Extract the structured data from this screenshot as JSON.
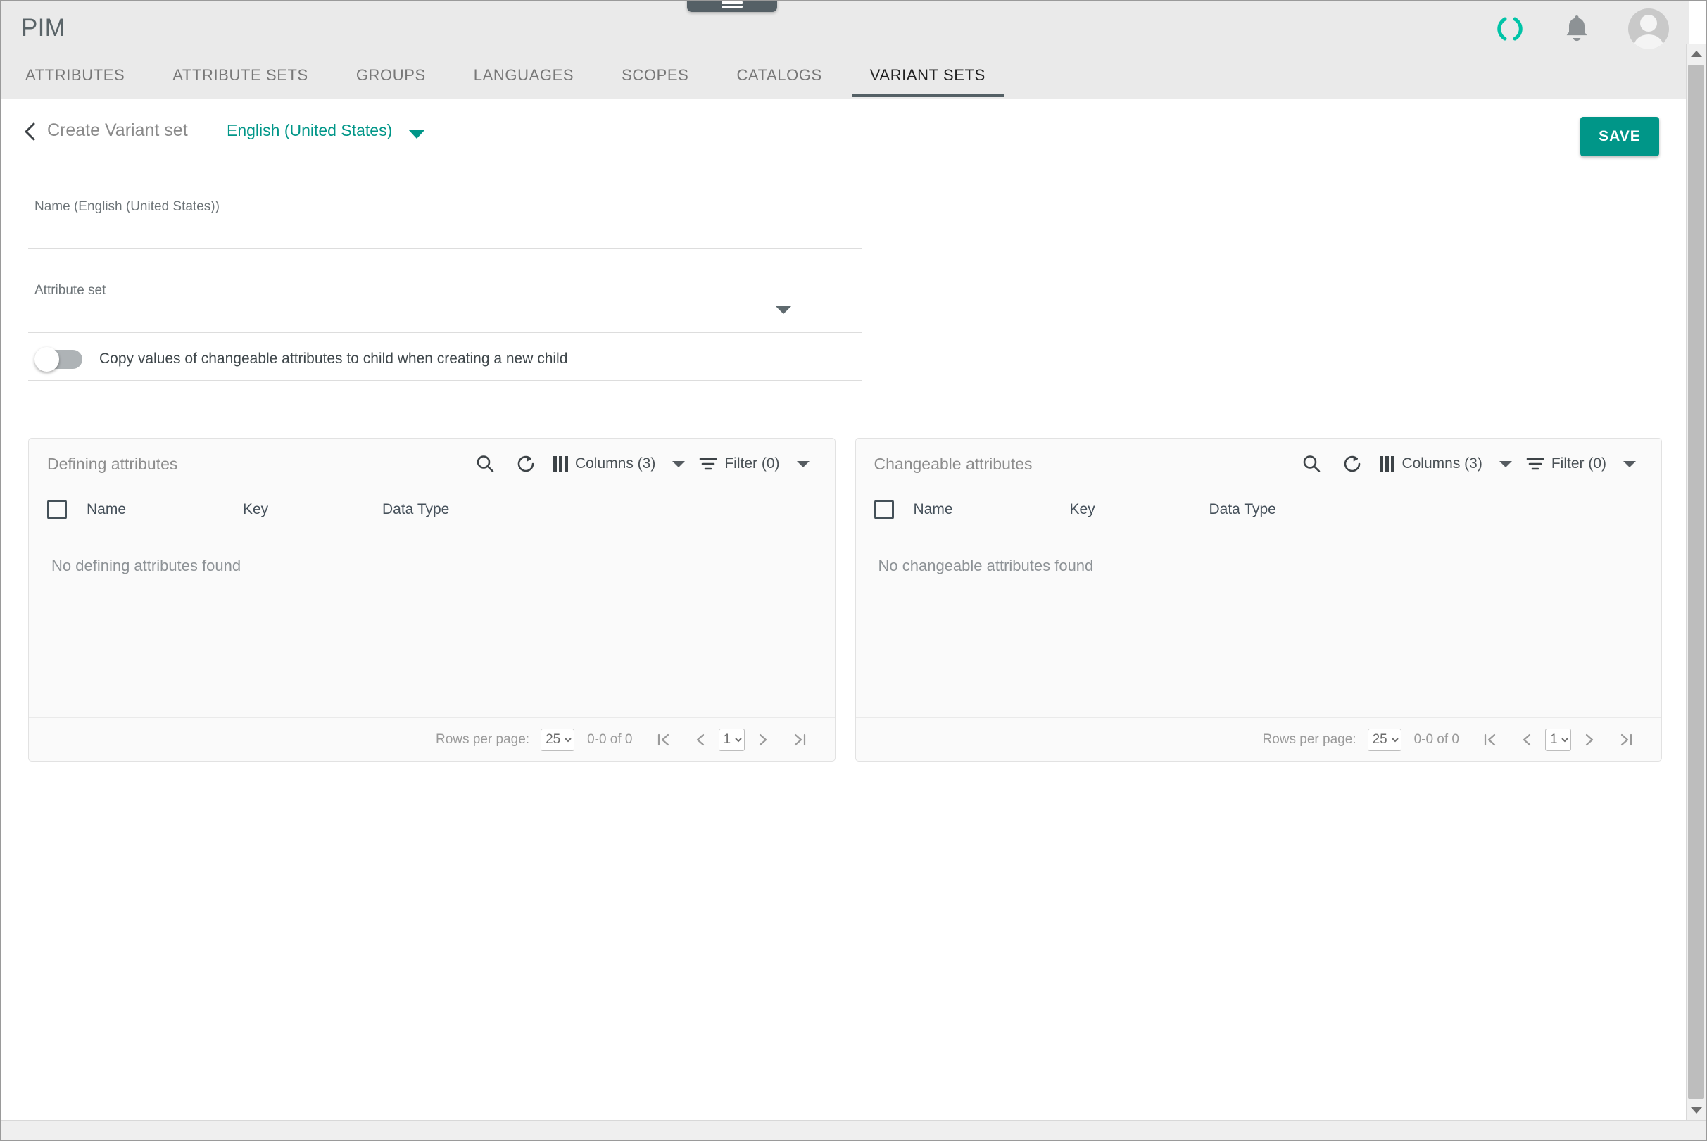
{
  "app": {
    "title": "PIM",
    "menu_tab_icon": "hamburger-icon",
    "status_icon": "loading-spinner-icon",
    "notifications_icon": "bell-icon",
    "avatar_icon": "user-avatar-icon",
    "accent_color": "#009688",
    "appbar_bg": "#eaeaea",
    "active_tab_underline": "#546065"
  },
  "tabs": [
    {
      "label": "ATTRIBUTES",
      "active": false
    },
    {
      "label": "ATTRIBUTE SETS",
      "active": false
    },
    {
      "label": "GROUPS",
      "active": false
    },
    {
      "label": "LANGUAGES",
      "active": false
    },
    {
      "label": "SCOPES",
      "active": false
    },
    {
      "label": "CATALOGS",
      "active": false
    },
    {
      "label": "VARIANT SETS",
      "active": true
    }
  ],
  "subheader": {
    "back_icon": "chevron-left-icon",
    "title": "Create Variant set",
    "language": "English (United States)",
    "language_caret_icon": "caret-down-icon",
    "save_label": "SAVE"
  },
  "form": {
    "name_label": "Name (English (United States))",
    "name_value": "",
    "name_placeholder": "",
    "attribute_set_label": "Attribute set",
    "attribute_set_value": "",
    "attribute_set_placeholder": "",
    "attribute_set_caret_icon": "caret-down-icon",
    "copy_toggle_label": "Copy values of changeable attributes to child when creating a new child",
    "copy_toggle_state": "off"
  },
  "panels": [
    {
      "title": "Defining attributes",
      "search_icon": "search-icon",
      "refresh_icon": "refresh-icon",
      "columns_icon": "columns-icon",
      "columns_label": "Columns (3)",
      "filter_icon": "filter-icon",
      "filter_label": "Filter (0)",
      "select_all_checkbox": "unchecked",
      "headers": [
        "Name",
        "Key",
        "Data Type"
      ],
      "rows": [],
      "empty_message": "No defining attributes found",
      "pagination": {
        "rows_per_page_label": "Rows per page:",
        "rows_per_page_value": "25",
        "rows_per_page_options": [
          "25"
        ],
        "range_text": "0-0 of 0",
        "page_value": "1",
        "page_options": [
          "1"
        ],
        "first_icon": "first-page-icon",
        "prev_icon": "previous-page-icon",
        "next_icon": "next-page-icon",
        "last_icon": "last-page-icon"
      }
    },
    {
      "title": "Changeable attributes",
      "search_icon": "search-icon",
      "refresh_icon": "refresh-icon",
      "columns_icon": "columns-icon",
      "columns_label": "Columns (3)",
      "filter_icon": "filter-icon",
      "filter_label": "Filter (0)",
      "select_all_checkbox": "unchecked",
      "headers": [
        "Name",
        "Key",
        "Data Type"
      ],
      "rows": [],
      "empty_message": "No changeable attributes found",
      "pagination": {
        "rows_per_page_label": "Rows per page:",
        "rows_per_page_value": "25",
        "rows_per_page_options": [
          "25"
        ],
        "range_text": "0-0 of 0",
        "page_value": "1",
        "page_options": [
          "1"
        ],
        "first_icon": "first-page-icon",
        "prev_icon": "previous-page-icon",
        "next_icon": "next-page-icon",
        "last_icon": "last-page-icon"
      }
    }
  ],
  "scrollbars": {
    "vertical_up_icon": "scroll-up-arrow-icon",
    "vertical_down_icon": "scroll-down-arrow-icon"
  }
}
